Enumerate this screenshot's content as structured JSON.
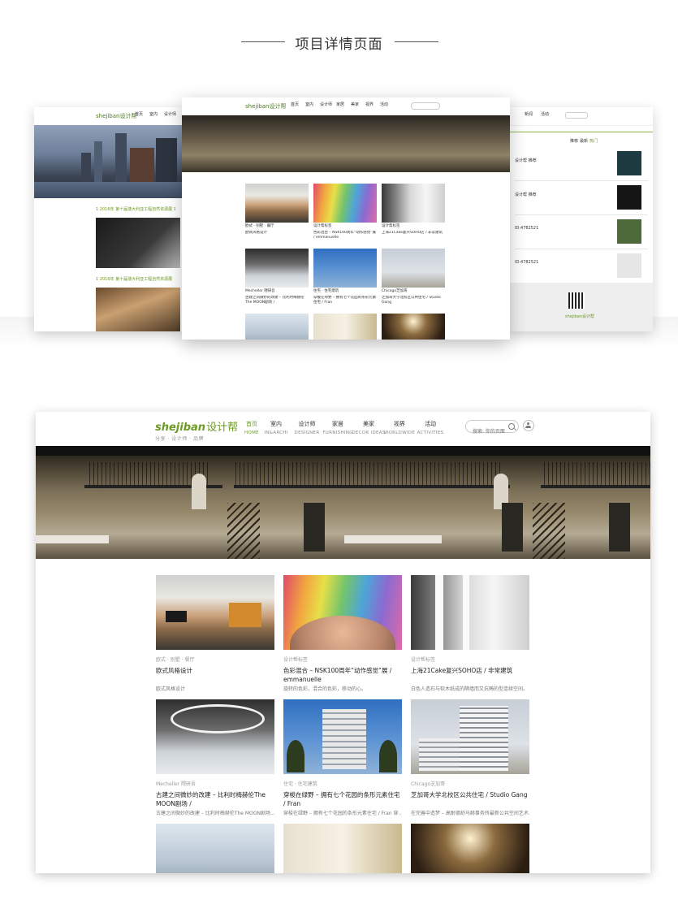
{
  "page_title": "项目详情页面",
  "preview": {
    "left_screen": {
      "logo": "shejiban设计帮",
      "nav": [
        "首页",
        "室内",
        "设计师"
      ],
      "posts": [
        "1 2016年 第十届澳大利亚工程自然资源展 1",
        "1 2016年 第十届澳大利亚工程自然资源展"
      ]
    },
    "center_screen": {
      "logo": "shejiban设计帮",
      "nav": [
        "首页",
        "室内",
        "设计师",
        "家居",
        "美家",
        "视界",
        "活动"
      ],
      "cards": [
        {
          "tag": "欧式 · 别墅 · 餐厅",
          "title": "欧式风格设计"
        },
        {
          "tag": "设计帮标签",
          "title": "色彩混合 – NSK100周年“动作感觉”展 / emmanuelle"
        },
        {
          "tag": "设计帮标签",
          "title": "上海21Cake复兴SOHO店 / 非常建筑"
        },
        {
          "tag": "Mecheller 隈研吾",
          "title": "古建之间微妙的改建 – 比利时梅赫伦The MOON剧场 /"
        },
        {
          "tag": "住宅 · 住宅建筑",
          "title": "穿梭在绿野 – 拥有七个花园的条形元素住宅 / Fran"
        },
        {
          "tag": "Chicago芝加哥",
          "title": "芝加哥大学北校区公共住宅 / Studio Gang"
        }
      ]
    },
    "right_screen": {
      "nav": [
        "新闻",
        "活动"
      ],
      "tabs": [
        "推荐",
        "最新",
        "热门"
      ],
      "items": [
        "设计帮 推荐",
        "设计帮 推荐",
        "ID:4782521",
        "ID:4782521"
      ],
      "footer_brand": "shejiban设计帮"
    }
  },
  "header": {
    "logo_text": "shejiban",
    "logo_cn": "设计帮",
    "logo_sub": "分享 · 设计师 · 品牌",
    "search_placeholder": "搜索: 你的页面"
  },
  "nav": [
    {
      "cn": "首页",
      "en": "HOME",
      "active": true
    },
    {
      "cn": "室内",
      "en": "IN&ARCHI",
      "active": false
    },
    {
      "cn": "设计师",
      "en": "DESIGNER",
      "active": false
    },
    {
      "cn": "家居",
      "en": "FURNISHING",
      "active": false
    },
    {
      "cn": "美家",
      "en": "DECOR IDEAS",
      "active": false
    },
    {
      "cn": "视界",
      "en": "WORLDWIDE",
      "active": false
    },
    {
      "cn": "活动",
      "en": "ACTIVITIES",
      "active": false
    }
  ],
  "cards": [
    {
      "tag": "欧式 · 别墅 · 餐厅",
      "title": "欧式风格设计",
      "desc": "欧式风格设计",
      "image": "kitchen"
    },
    {
      "tag": "设计帮标签",
      "title": "色彩混合 – NSK100周年“动作感觉”展 / emmanuelle",
      "desc": "旋转的色彩，混合的色彩，移动的心。",
      "image": "rainbow"
    },
    {
      "tag": "设计帮标签",
      "title": "上海21Cake复兴SOHO店 / 非常建筑",
      "desc": "白色人造石与软木纸成的隔墙而又抗畸的型连续空间。",
      "image": "white-store"
    },
    {
      "tag": "Mecheller 隈研吾",
      "title": "古建之间微妙的改建 – 比利时梅赫伦The MOON剧场 /",
      "desc": "古建之间微妙的改建 – 比利时梅赫伦The MOON剧场...",
      "image": "ring-lobby"
    },
    {
      "tag": "住宅 · 住宅建筑",
      "title": "穿梭在绿野 – 拥有七个花园的条形元素住宅 / Fran",
      "desc": "穿梭在绿野 – 拥有七个花园的条形元素住宅 / Fran 穿...",
      "image": "building-blue"
    },
    {
      "tag": "Chicago芝加哥",
      "title": "芝加哥大学北校区公共住宅 / Studio Gang",
      "desc": "在完善中造梦 – 高耐德舒马赫事务所最新公共空间艺术...",
      "image": "building-grey"
    },
    {
      "tag": "",
      "title": "",
      "desc": "",
      "image": "office"
    },
    {
      "tag": "",
      "title": "",
      "desc": "",
      "image": "corridor"
    },
    {
      "tag": "",
      "title": "",
      "desc": "",
      "image": "chandelier"
    }
  ],
  "colors": {
    "brand": "#6a9a22",
    "text": "#333333",
    "muted": "#999999"
  }
}
